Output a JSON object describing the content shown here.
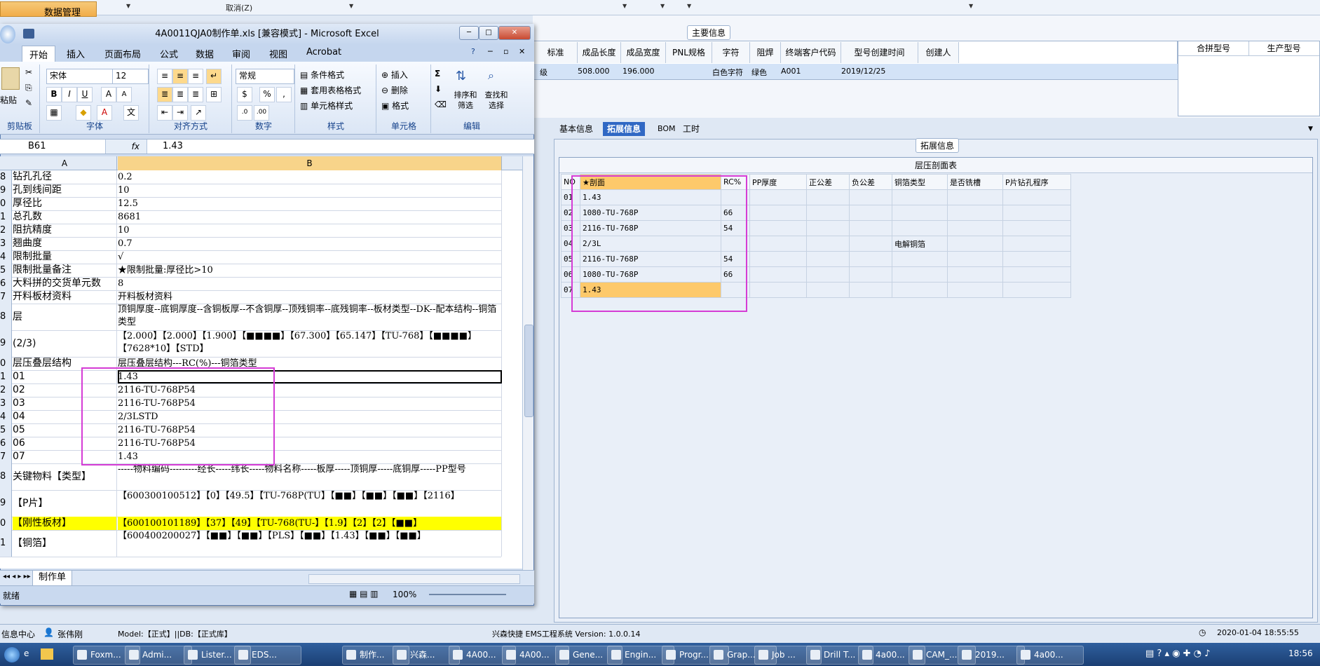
{
  "app": {
    "data_mgmt": "数据管理",
    "cancel": "取消(Z)"
  },
  "main_info": {
    "group_title": "主要信息",
    "columns": [
      "标准",
      "成品长度",
      "成品宽度",
      "PNL规格",
      "字符",
      "阻焊",
      "终端客户代码",
      "型号创建时间",
      "创建人"
    ],
    "row": [
      "级",
      "508.000",
      "196.000",
      "",
      "白色字符",
      "绿色",
      "A001",
      "2019/12/25",
      ""
    ],
    "side_columns": [
      "合拼型号",
      "生产型号"
    ]
  },
  "tabs": [
    "基本信息",
    "拓展信息",
    "BOM",
    "工时"
  ],
  "ext": {
    "group_title": "拓展信息",
    "stack_title": "层压剖面表",
    "headers": [
      "NO",
      "★剖面",
      "RC%",
      "PP厚度",
      "正公差",
      "负公差",
      "铜箔类型",
      "是否铣槽",
      "P片钻孔程序"
    ],
    "rows": [
      [
        "01",
        "1.43",
        "",
        "",
        "",
        "",
        "",
        "",
        ""
      ],
      [
        "02",
        "1080-TU-768P",
        "66",
        "",
        "",
        "",
        "",
        "",
        ""
      ],
      [
        "03",
        "2116-TU-768P",
        "54",
        "",
        "",
        "",
        "",
        "",
        ""
      ],
      [
        "04",
        "2/3L",
        "",
        "",
        "",
        "",
        "电解铜箔",
        "",
        ""
      ],
      [
        "05",
        "2116-TU-768P",
        "54",
        "",
        "",
        "",
        "",
        "",
        ""
      ],
      [
        "06",
        "1080-TU-768P",
        "66",
        "",
        "",
        "",
        "",
        "",
        ""
      ],
      [
        "07",
        "1.43",
        "",
        "",
        "",
        "",
        "",
        "",
        ""
      ]
    ]
  },
  "excel": {
    "title": "4A0011QJA0制作单.xls  [兼容模式] - Microsoft Excel",
    "ribbon_tabs": [
      "开始",
      "插入",
      "页面布局",
      "公式",
      "数据",
      "审阅",
      "视图",
      "Acrobat"
    ],
    "paste": "粘贴",
    "font_name": "宋体",
    "font_size": "12",
    "number_format": "常规",
    "groups": [
      "剪贴板",
      "字体",
      "对齐方式",
      "数字",
      "样式",
      "单元格",
      "编辑"
    ],
    "style_items": [
      "条件格式",
      "套用表格格式",
      "单元格样式"
    ],
    "cell_items": [
      "插入",
      "删除",
      "格式"
    ],
    "edit_items": [
      "排序和筛选",
      "查找和选择"
    ],
    "name_box": "B61",
    "fx": "fx",
    "formula_value": "1.43",
    "col_a": "A",
    "col_b": "B",
    "sheet_tab": "制作单",
    "zoom": "100%",
    "status": "就绪",
    "rows": [
      {
        "n": "8",
        "a": "钻孔孔径",
        "b": "0.2"
      },
      {
        "n": "9",
        "a": "孔到线间距",
        "b": "10"
      },
      {
        "n": "0",
        "a": "厚径比",
        "b": "12.5"
      },
      {
        "n": "1",
        "a": "总孔数",
        "b": "8681"
      },
      {
        "n": "2",
        "a": "阻抗精度",
        "b": "10"
      },
      {
        "n": "3",
        "a": "翘曲度",
        "b": "0.7"
      },
      {
        "n": "4",
        "a": "限制批量",
        "b": "√"
      },
      {
        "n": "5",
        "a": "限制批量备注",
        "b": "★限制批量:厚径比>10"
      },
      {
        "n": "6",
        "a": "大料拼的交货单元数",
        "b": "8"
      },
      {
        "n": "7",
        "a": "开料板材资料",
        "b": "开料板材资料"
      },
      {
        "n": "8",
        "a": "层",
        "b": "顶铜厚度--底铜厚度--含铜板厚--不含铜厚--顶残铜率--底残铜率--板材类型--DK--配本结构--铜箔类型"
      },
      {
        "n": "9",
        "a": "(2/3)",
        "b": "【2.000】【2.000】【1.900】【■■■■】【67.300】【65.147】【TU-768】【■■■■】【7628*10】【STD】"
      },
      {
        "n": "0",
        "a": "层压叠层结构",
        "b": "层压叠层结构---RC(%)---铜箔类型"
      },
      {
        "n": "1",
        "a": "01",
        "b": "1.43"
      },
      {
        "n": "2",
        "a": "02",
        "b": "2116-TU-768P54"
      },
      {
        "n": "3",
        "a": "03",
        "b": "2116-TU-768P54"
      },
      {
        "n": "4",
        "a": "04",
        "b": "2/3LSTD"
      },
      {
        "n": "5",
        "a": "05",
        "b": "2116-TU-768P54"
      },
      {
        "n": "6",
        "a": "06",
        "b": "2116-TU-768P54"
      },
      {
        "n": "7",
        "a": "07",
        "b": "1.43"
      },
      {
        "n": "8",
        "a": "关键物料【类型】",
        "b": "-----物料编码---------经长-----纬长-----物料名称-----板厚-----顶铜厚-----底铜厚-----PP型号"
      },
      {
        "n": "9",
        "a": "【P片】",
        "b": "【600300100512】【0】【49.5】【TU-768P(TU】【■■】【■■】【■■】【2116】"
      },
      {
        "n": "0",
        "a": "【刚性板材】",
        "b": "【600100101189】【37】【49】【TU-768(TU-】【1.9】【2】【2】【■■】"
      },
      {
        "n": "1",
        "a": "【铜箔】",
        "b": "【600400200027】【■■】【■■】【PLS】【■■】【1.43】【■■】【■■】"
      }
    ]
  },
  "erp_status": {
    "info_center": "信息中心",
    "user": "张伟刚",
    "model": "Model:【正式】||DB:【正式库】",
    "system": "兴森快捷 EMS工程系统 Version: 1.0.0.14",
    "datetime": "2020-01-04 18:55:55"
  },
  "taskbar": {
    "items": [
      "Foxm...",
      "Admi...",
      "Lister...",
      "EDS...",
      "制作...",
      "兴森...",
      "4A00...",
      "4A00...",
      "Gene...",
      "Engin...",
      "Progr...",
      "Grap...",
      "Job ...",
      "Drill T...",
      "4a00...",
      "CAM_...",
      "2019...",
      "4a00..."
    ],
    "clock": "18:56"
  },
  "colors": {
    "magenta": "#d53cd5",
    "selected_tab": "#3068c4",
    "highlight_yellow": "#ffff00",
    "active_cell": "#fdc96b"
  }
}
